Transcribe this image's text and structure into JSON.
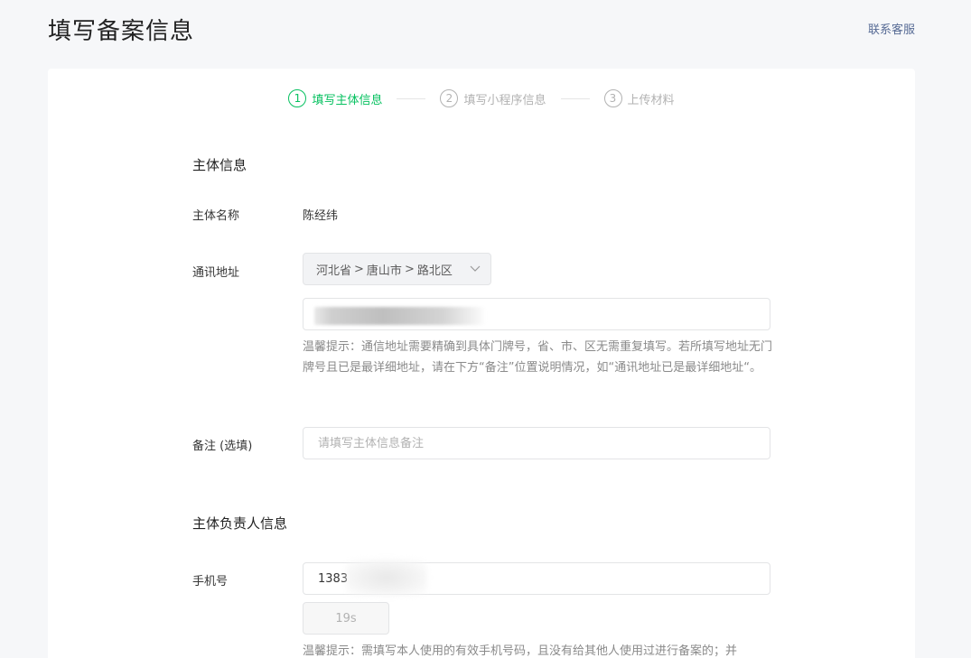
{
  "header": {
    "title": "填写备案信息",
    "contact_label": "联系客服"
  },
  "steps": [
    {
      "num": "1",
      "label": "填写主体信息",
      "active": true
    },
    {
      "num": "2",
      "label": "填写小程序信息",
      "active": false
    },
    {
      "num": "3",
      "label": "上传材料",
      "active": false
    }
  ],
  "subject_info": {
    "section_title": "主体信息",
    "name_label": "主体名称",
    "name_value": "陈经纬",
    "address_label": "通讯地址",
    "region": {
      "province": "河北省",
      "city": "唐山市",
      "district": "路北区",
      "separator": ">"
    },
    "address_hint": "温馨提示：通信地址需要精确到具体门牌号，省、市、区无需重复填写。若所填写地址无门牌号且已是最详细地址，请在下方“备注”位置说明情况，如“通讯地址已是最详细地址“。",
    "remark_label": "备注 (选填)",
    "remark_placeholder": "请填写主体信息备注"
  },
  "responsible_info": {
    "section_title": "主体负责人信息",
    "phone_label": "手机号",
    "phone_value": "1383",
    "code_button_label": "19s",
    "phone_hint": "温馨提示：需填写本人使用的有效手机号码，且没有给其他人使用过进行备案的；并"
  },
  "colors": {
    "accent": "#07c160",
    "link": "#576b95",
    "muted": "#b2b2b2",
    "hint": "#8a8a8a"
  }
}
